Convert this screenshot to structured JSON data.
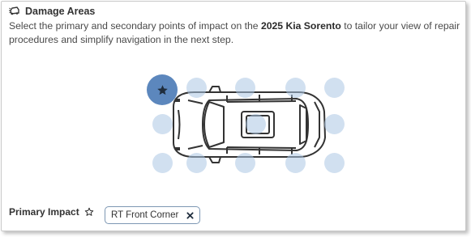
{
  "header": {
    "title": "Damage Areas",
    "icon": "car-crash-icon"
  },
  "description": {
    "before": "Select the primary and secondary points of impact on the ",
    "vehicle": "2025 Kia Sorento",
    "after": " to tailor your view of repair procedures and simplify navigation in the next step."
  },
  "impact_map": {
    "selected_point": "front-right-corner",
    "points": [
      "row1-col1",
      "row1-col2",
      "row1-col3",
      "row1-col4",
      "row1-col5",
      "row2-col1",
      "row2-col3",
      "row2-col5",
      "row3-col1",
      "row3-col2",
      "row3-col3",
      "row3-col4",
      "row3-col5"
    ]
  },
  "primary_impact": {
    "label": "Primary Impact",
    "star_icon": "star-outline-icon",
    "chip_label": "RT Front Corner",
    "remove_icon": "close-icon"
  },
  "colors": {
    "selected": "#5c87bd",
    "point": "#abc7e3",
    "chip_border": "#7d97b3"
  }
}
